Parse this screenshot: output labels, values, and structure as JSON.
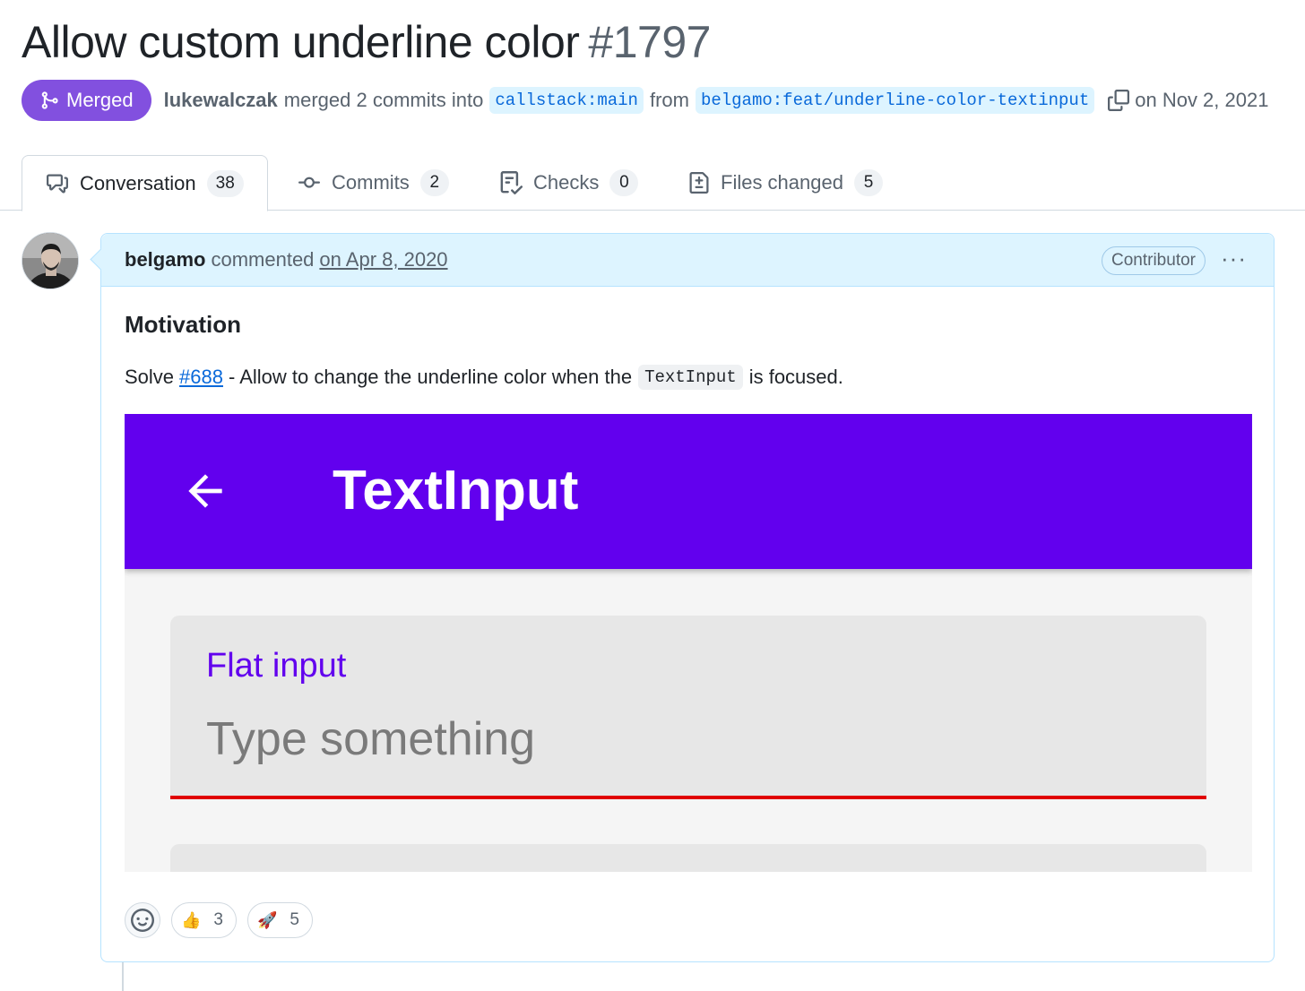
{
  "pr": {
    "title": "Allow custom underline color",
    "number": "#1797",
    "state": "Merged",
    "author": "lukewalczak",
    "merged_text": "merged 2 commits into",
    "base_branch": "callstack:main",
    "from_text": "from",
    "head_branch": "belgamo:feat/underline-color-textinput",
    "date": "on Nov 2, 2021"
  },
  "tabs": [
    {
      "label": "Conversation",
      "count": "38",
      "icon": "comment-discussion-icon"
    },
    {
      "label": "Commits",
      "count": "2",
      "icon": "git-commit-icon"
    },
    {
      "label": "Checks",
      "count": "0",
      "icon": "checklist-icon"
    },
    {
      "label": "Files changed",
      "count": "5",
      "icon": "file-diff-icon"
    }
  ],
  "comment": {
    "author": "belgamo",
    "action": "commented",
    "date": "on Apr 8, 2020",
    "badge": "Contributor",
    "menu": "···",
    "heading": "Motivation",
    "body_prefix": "Solve",
    "issue_link": "#688",
    "body_mid": "- Allow to change the underline color when the",
    "code": "TextInput",
    "body_suffix": "is focused.",
    "screenshot": {
      "app_title": "TextInput",
      "field_label": "Flat input",
      "placeholder": "Type something",
      "appbar_color": "#6200ee",
      "underline_color": "#e00000"
    },
    "reactions": [
      {
        "emoji": "👍",
        "count": "3",
        "name": "thumbs-up"
      },
      {
        "emoji": "🚀",
        "count": "5",
        "name": "rocket"
      }
    ]
  },
  "colors": {
    "merged": "#8250df",
    "link": "#0969da",
    "header_bg": "#ddf4ff"
  }
}
